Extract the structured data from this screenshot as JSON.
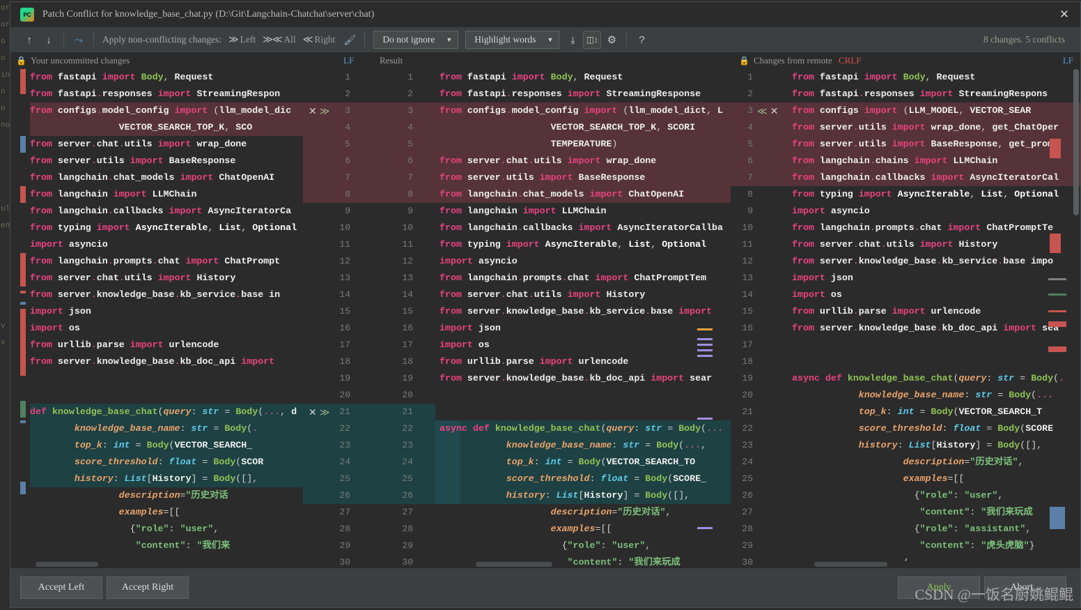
{
  "window": {
    "title": "Patch Conflict for knowledge_base_chat.py (D:\\Git\\Langchain-Chatchat\\server\\chat)",
    "app_icon": "PC",
    "close_icon": "✕"
  },
  "toolbar": {
    "prev_icon": "↑",
    "next_icon": "↓",
    "magic_apply_icon": "⤳",
    "apply_label": "Apply non-conflicting changes:",
    "apply_left": "Left",
    "apply_all": "All",
    "apply_right": "Right",
    "left_chevron": "≫",
    "all_chevron": "≫≪",
    "right_chevron": "≪",
    "wand_icon": "✨",
    "ignore_select": "Do not ignore",
    "highlight_select": "Highlight words",
    "caret": "▼",
    "collapse_icon": "⤓",
    "columns_icon": "↕",
    "gear_icon": "⚙",
    "help_icon": "?",
    "changes_summary": "8 changes. 5 conflicts"
  },
  "headers": {
    "left": "Your uncommitted changes",
    "left_lf": "LF",
    "result": "Result",
    "result_crlf": "CRLF",
    "right": "Changes from remote",
    "right_lf": "LF",
    "lock_icon": "🔒"
  },
  "footer": {
    "accept_left": "Accept Left",
    "accept_right": "Accept Right",
    "apply": "Apply",
    "abort": "Abort...",
    "watermark": "CSDN @一饭名厨姚鲲鲲"
  },
  "background_gutter": [
    "or",
    "or",
    "o",
    "o",
    "in",
    "n",
    "n",
    "no",
    "",
    "",
    "",
    "",
    "ult",
    "en",
    "",
    "",
    "",
    "",
    "",
    "v s",
    "x",
    "",
    "",
    "",
    "",
    "",
    ""
  ],
  "left_pane": {
    "lines": [
      "from fastapi import Body, Request",
      "from fastapi.responses import StreamingRespon",
      "from configs.model_config import (llm_model_dic",
      "                VECTOR_SEARCH_TOP_K, SCO",
      "from server.chat.utils import wrap_done",
      "from server.utils import BaseResponse",
      "from langchain.chat_models import ChatOpenAI",
      "from langchain import LLMChain",
      "from langchain.callbacks import AsyncIteratorCa",
      "from typing import AsyncIterable, List, Optional",
      "import asyncio",
      "from langchain.prompts.chat import ChatPrompt",
      "from server.chat.utils import History",
      "from server.knowledge_base.kb_service.base in",
      "import json",
      "import os",
      "from urllib.parse import urlencode",
      "from server.knowledge_base.kb_doc_api import",
      "",
      "",
      "def knowledge_base_chat(query: str = Body(..., d",
      "        knowledge_base_name: str = Body(.",
      "        top_k: int = Body(VECTOR_SEARCH_",
      "        score_threshold: float = Body(SCOR",
      "        history: List[History] = Body([],",
      "                description=\"历史对话",
      "                examples=[[",
      "                  {\"role\": \"user\",",
      "                   \"content\": \"我们来"
    ]
  },
  "result_pane": {
    "lines": [
      "from fastapi import Body, Request",
      "from fastapi.responses import StreamingResponse",
      "from configs.model_config import (llm_model_dict, L",
      "                    VECTOR_SEARCH_TOP_K, SCORI",
      "                    TEMPERATURE)",
      "from server.chat.utils import wrap_done",
      "from server.utils import BaseResponse",
      "from langchain.chat_models import ChatOpenAI",
      "from langchain import LLMChain",
      "from langchain.callbacks import AsyncIteratorCallba",
      "from typing import AsyncIterable, List, Optional",
      "import asyncio",
      "from langchain.prompts.chat import ChatPromptTem",
      "from server.chat.utils import History",
      "from server.knowledge_base.kb_service.base import",
      "import json",
      "import os",
      "from urllib.parse import urlencode",
      "from server.knowledge_base.kb_doc_api import sear",
      "",
      "",
      "async def knowledge_base_chat(query: str = Body(...",
      "            knowledge_base_name: str = Body(...,",
      "            top_k: int = Body(VECTOR_SEARCH_TO",
      "            score_threshold: float = Body(SCORE_",
      "            history: List[History] = Body([],",
      "                    description=\"历史对话\",",
      "                    examples=[[",
      "                      {\"role\": \"user\",",
      "                       \"content\": \"我们来玩成"
    ],
    "line_numbers_left": [
      "1",
      "2",
      "3",
      "4",
      "5",
      "6",
      "7",
      "8",
      "9",
      "10",
      "11",
      "12",
      "13",
      "14",
      "15",
      "16",
      "17",
      "18",
      "19",
      "20",
      "21",
      "22",
      "23",
      "24",
      "25",
      "26",
      "27",
      "28",
      "29",
      "30"
    ],
    "line_numbers_right": [
      "1",
      "2",
      "3",
      "4",
      "5",
      "6",
      "7",
      "8",
      "9",
      "10",
      "11",
      "12",
      "13",
      "14",
      "15",
      "16",
      "17",
      "18",
      "19",
      "20",
      "21",
      "22",
      "23",
      "24",
      "25",
      "26",
      "27",
      "28",
      "29",
      "30"
    ]
  },
  "right_pane": {
    "lines": [
      "from fastapi import Body, Request",
      "from fastapi.responses import StreamingRespons",
      "from configs import (LLM_MODEL, VECTOR_SEAR",
      "from server.utils import wrap_done, get_ChatOper",
      "from server.utils import BaseResponse, get_prom",
      "from langchain.chains import LLMChain",
      "from langchain.callbacks import AsyncIteratorCal",
      "from typing import AsyncIterable, List, Optional",
      "import asyncio",
      "from langchain.prompts.chat import ChatPromptTe",
      "from server.chat.utils import History",
      "from server.knowledge_base.kb_service.base impo",
      "import json",
      "import os",
      "from urllib.parse import urlencode",
      "from server.knowledge_base.kb_doc_api import sea",
      "",
      "",
      "async def knowledge_base_chat(query: str = Body(.",
      "            knowledge_base_name: str = Body(...",
      "            top_k: int = Body(VECTOR_SEARCH_T",
      "            score_threshold: float = Body(SCORE",
      "            history: List[History] = Body([],",
      "                    description=\"历史对话\",",
      "                    examples=[[",
      "                      {\"role\": \"user\",",
      "                       \"content\": \"我们来玩成",
      "                      {\"role\": \"assistant\",",
      "                       \"content\": \"虎头虎脑\"}",
      "                    ‘"
    ],
    "line_numbers": [
      "1",
      "2",
      "3",
      "4",
      "5",
      "6",
      "7",
      "8",
      "9",
      "10",
      "11",
      "12",
      "13",
      "14",
      "15",
      "16",
      "17",
      "18",
      "19",
      "20",
      "21",
      "22",
      "23",
      "24",
      "25",
      "26",
      "27",
      "28",
      "29",
      "30"
    ]
  },
  "conflict_markers": {
    "mid_x": "✕",
    "mid_right_chev": "≫",
    "right_left_chev": "≪",
    "right_x": "✕",
    "conflict_line_1": "3",
    "conflict_line_2": "21"
  },
  "colors": {
    "deleted": "#4b2526",
    "inserted": "#1e4143",
    "accent_blue": "#5a9bd5",
    "apply_green": "#8ec254",
    "crlf_red": "#d9534f"
  }
}
